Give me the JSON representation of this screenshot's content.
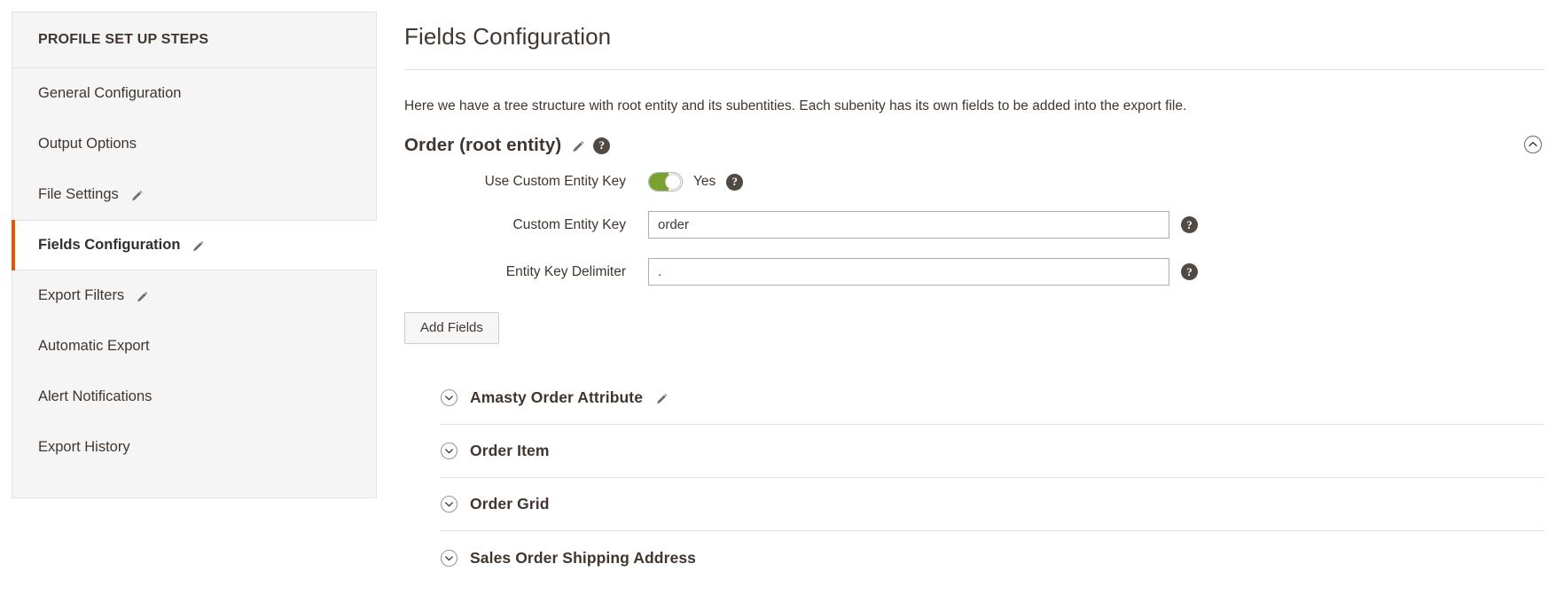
{
  "sidebar": {
    "title": "PROFILE SET UP STEPS",
    "items": [
      {
        "label": "General Configuration",
        "edit": false,
        "active": false
      },
      {
        "label": "Output Options",
        "edit": false,
        "active": false
      },
      {
        "label": "File Settings",
        "edit": true,
        "active": false
      },
      {
        "label": "Fields Configuration",
        "edit": true,
        "active": true
      },
      {
        "label": "Export Filters",
        "edit": true,
        "active": false
      },
      {
        "label": "Automatic Export",
        "edit": false,
        "active": false
      },
      {
        "label": "Alert Notifications",
        "edit": false,
        "active": false
      },
      {
        "label": "Export History",
        "edit": false,
        "active": false
      }
    ]
  },
  "main": {
    "page_title": "Fields Configuration",
    "intro": "Here we have a tree structure with root entity and its subentities. Each subenity has its own fields to be added into the export file.",
    "section": {
      "title": "Order (root entity)",
      "edit_icon": "pencil-icon",
      "help_icon": "help-icon",
      "collapse_icon": "chevron-up-circle-icon"
    },
    "fields": {
      "use_custom_entity_key": {
        "label": "Use Custom Entity Key",
        "toggle_state": "Yes",
        "toggle_on": true
      },
      "custom_entity_key": {
        "label": "Custom Entity Key",
        "value": "order",
        "placeholder": ""
      },
      "entity_key_delimiter": {
        "label": "Entity Key Delimiter",
        "value": ".",
        "placeholder": ""
      }
    },
    "add_fields_label": "Add Fields",
    "entities": [
      {
        "name": "Amasty Order Attribute",
        "edit": true
      },
      {
        "name": "Order Item",
        "edit": false
      },
      {
        "name": "Order Grid",
        "edit": false
      },
      {
        "name": "Sales Order Shipping Address",
        "edit": false
      }
    ]
  },
  "colors": {
    "accent": "#eb5202",
    "toggle_on": "#79a22e",
    "help_bubble": "#514943",
    "text": "#41362f",
    "panel": "#f5f5f5",
    "border": "#e3e3e3"
  }
}
